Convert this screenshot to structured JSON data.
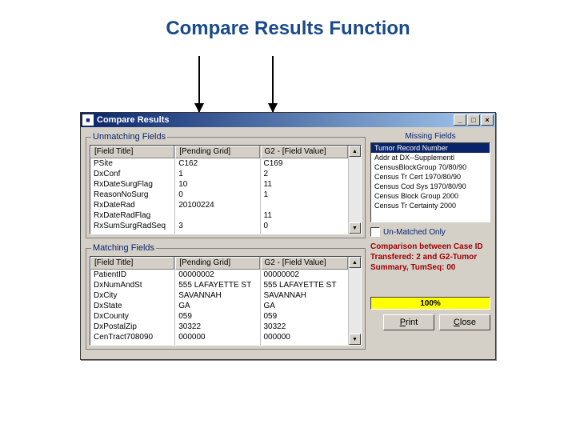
{
  "page": {
    "title": "Compare Results Function"
  },
  "window": {
    "title": "Compare Results",
    "titlebar": {
      "min": "_",
      "max": "□",
      "close": "×"
    }
  },
  "unmatching": {
    "legend": "Unmatching Fields",
    "headers": {
      "title": "[Field Title]",
      "pending": "[Pending Grid]",
      "g2": "G2 - [Field Value]"
    },
    "rows": [
      {
        "title": "PSite",
        "pending": "C162",
        "g2": "C169"
      },
      {
        "title": "DxConf",
        "pending": "1",
        "g2": "2"
      },
      {
        "title": "RxDateSurgFlag",
        "pending": "10",
        "g2": "11"
      },
      {
        "title": "ReasonNoSurg",
        "pending": "0",
        "g2": "1"
      },
      {
        "title": "RxDateRad",
        "pending": "20100224",
        "g2": ""
      },
      {
        "title": "RxDateRadFlag",
        "pending": "",
        "g2": "11"
      },
      {
        "title": "RxSumSurgRadSeq",
        "pending": "3",
        "g2": "0"
      }
    ]
  },
  "matching": {
    "legend": "Matching Fields",
    "headers": {
      "title": "[Field Title]",
      "pending": "[Pending Grid]",
      "g2": "G2 - [Field Value]"
    },
    "rows": [
      {
        "title": "PatientID",
        "pending": "00000002",
        "g2": "00000002"
      },
      {
        "title": "DxNumAndSt",
        "pending": "555 LAFAYETTE ST",
        "g2": "555 LAFAYETTE ST"
      },
      {
        "title": "DxCity",
        "pending": "SAVANNAH",
        "g2": "SAVANNAH"
      },
      {
        "title": "DxState",
        "pending": "GA",
        "g2": "GA"
      },
      {
        "title": "DxCounty",
        "pending": "059",
        "g2": "059"
      },
      {
        "title": "DxPostalZip",
        "pending": "30322",
        "g2": "30322"
      },
      {
        "title": "CenTract708090",
        "pending": "000000",
        "g2": "000000"
      }
    ]
  },
  "missing": {
    "title": "Missing Fields",
    "items": [
      "Tumor Record Number",
      "Addr at DX--Supplementl",
      "CensusBlockGroup 70/80/90",
      "Census Tr Cert 1970/80/90",
      "Census Cod Sys 1970/80/90",
      "Census Block Group 2000",
      "Census Tr Certainty 2000"
    ]
  },
  "sidebar": {
    "unmatched_only": "Un-Matched Only",
    "info": "Comparison between Case ID Transfered: 2 and G2-Tumor Summary, TumSeq: 00",
    "progress": "100%"
  },
  "buttons": {
    "print": "Print",
    "close": "Close"
  }
}
